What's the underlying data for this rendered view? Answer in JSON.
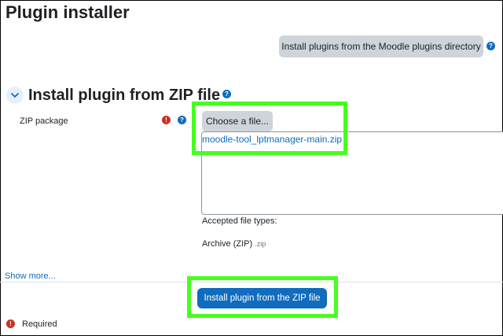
{
  "page": {
    "title": "Plugin installer"
  },
  "directory_button": {
    "label": "Install plugins from the Moodle plugins directory"
  },
  "section": {
    "title": "Install plugin from ZIP file"
  },
  "zip_field": {
    "label": "ZIP package",
    "choose_label": "Choose a file...",
    "selected_file": "moodle-tool_lptmanager-main.zip",
    "accepted_label": "Accepted file types:",
    "accepted_type": "Archive (ZIP)",
    "accepted_ext": ".zip"
  },
  "show_more": "Show more...",
  "install_button": {
    "label": "Install plugin from the ZIP file"
  },
  "required": {
    "label": "Required"
  },
  "icons": {
    "help": "?",
    "required": "!",
    "chevron": "chevron-down"
  },
  "colors": {
    "primary": "#0f6cbf",
    "secondary_button": "#ced4da",
    "danger": "#ca3120",
    "highlight": "#45ff1e"
  }
}
